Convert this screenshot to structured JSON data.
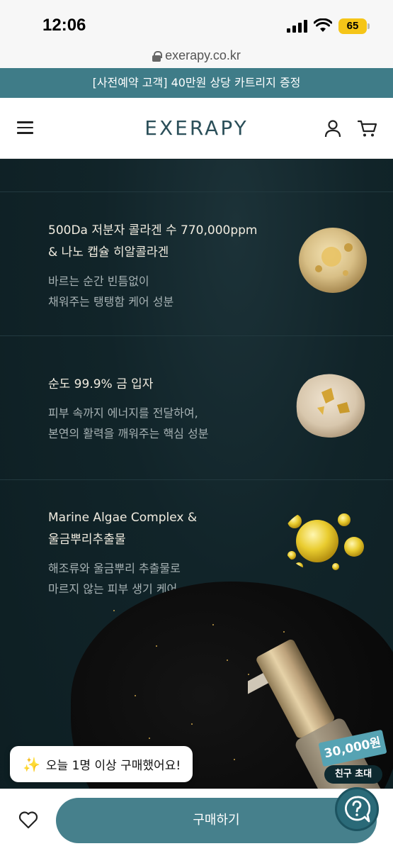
{
  "status_bar": {
    "time": "12:06",
    "battery": "65"
  },
  "browser": {
    "url": "exerapy.co.kr"
  },
  "promo_banner": "[사전예약 고객] 40만원 상당 카트리지 증정",
  "header": {
    "logo": "EXERAPY"
  },
  "features": [
    {
      "title": "500Da 저분자 콜라겐 수 770,000ppm\n& 나노 캡슐 히알콜라겐",
      "description": "바르는 순간 빈틈없이\n채워주는 탱탱함 케어 성분"
    },
    {
      "title": "순도 99.9% 금 입자",
      "description": "피부 속까지 에너지를 전달하여,\n본연의 활력을 깨워주는 핵심 성분"
    },
    {
      "title": "Marine Algae Complex &\n울금뿌리추출물",
      "description": "해조류와 울금뿌리 추출물로\n마르지 않는 피부 생기 케어"
    }
  ],
  "notice": {
    "text": "오늘 1명 이상 구매했어요!"
  },
  "referral": {
    "amount": "30,000원",
    "label": "친구 초대"
  },
  "bottom_bar": {
    "buy_label": "구매하기"
  },
  "colors": {
    "promo_bg": "#3f7c88",
    "logo": "#2b4f59",
    "buy_button": "#46808c",
    "background": "#0f2226"
  }
}
